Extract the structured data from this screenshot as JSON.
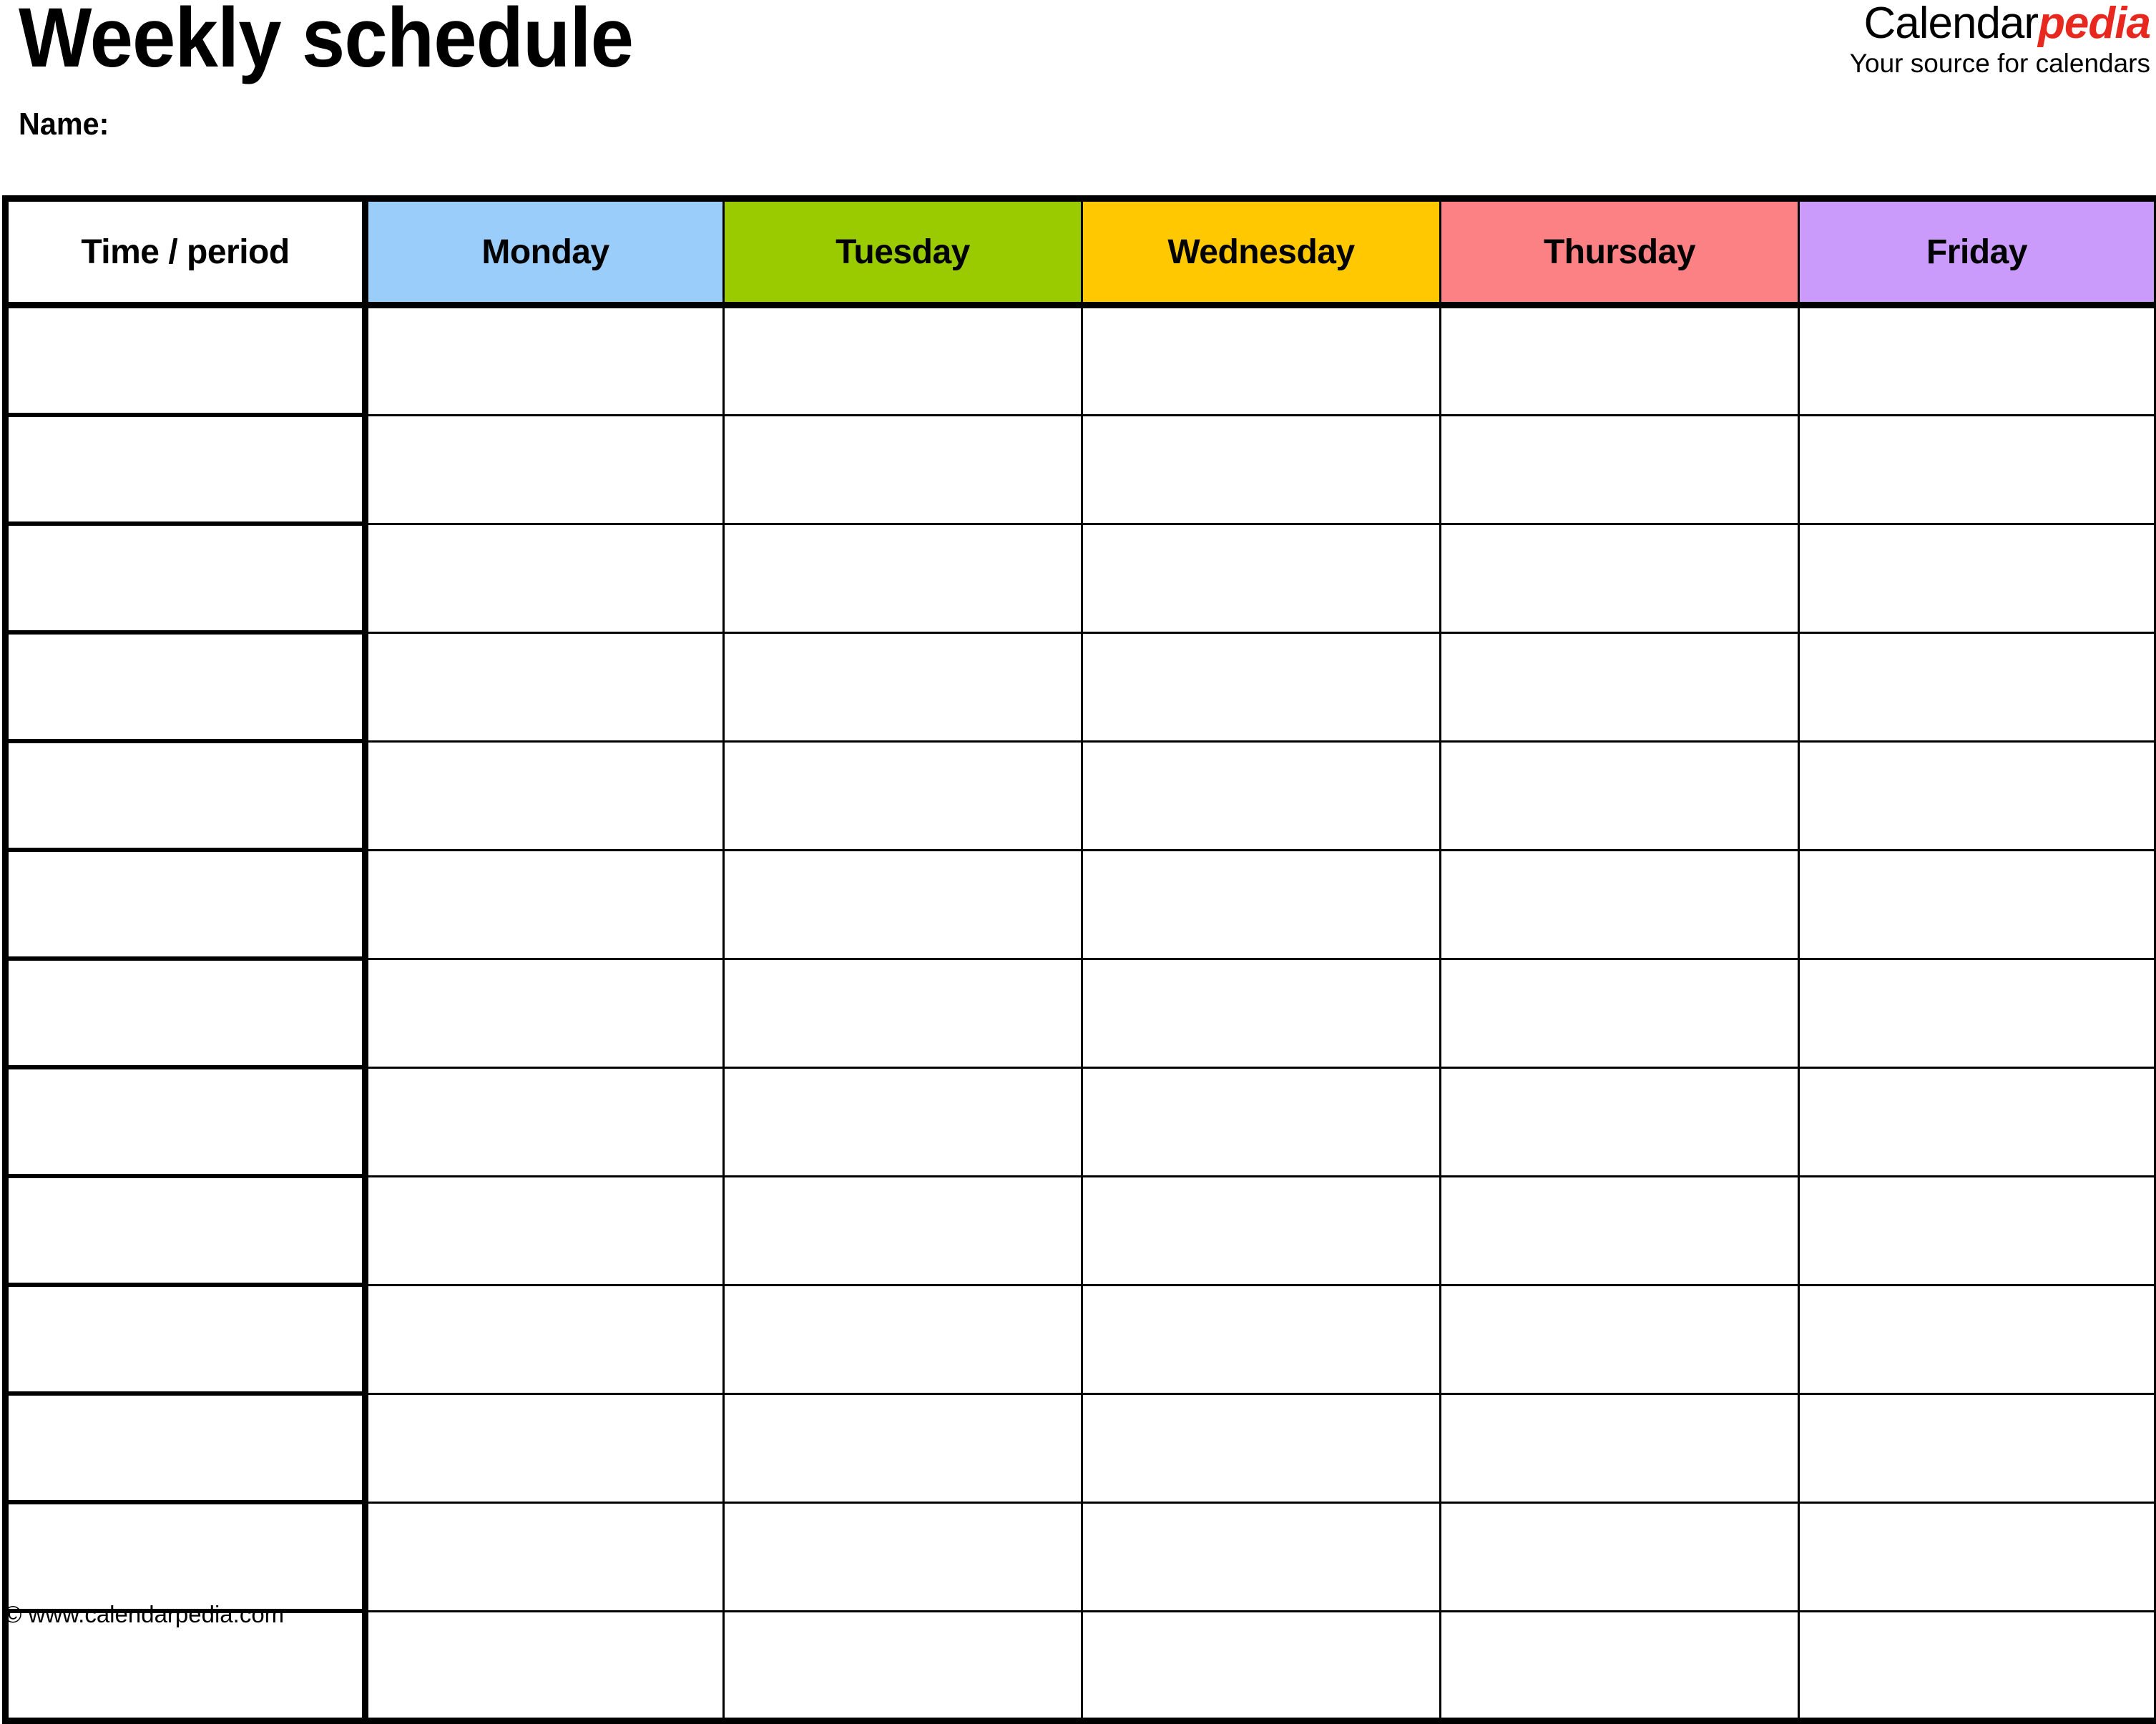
{
  "header": {
    "title": "Weekly schedule",
    "name_label": "Name:"
  },
  "brand": {
    "word_1": "Calendar",
    "word_2": "pedia",
    "tagline": "Your source for calendars",
    "accent_color": "#e8281e"
  },
  "table": {
    "columns": [
      {
        "label": "Time / period",
        "color": "#ffffff"
      },
      {
        "label": "Monday",
        "color": "#9bcdfb"
      },
      {
        "label": "Tuesday",
        "color": "#9aca00"
      },
      {
        "label": "Wednesday",
        "color": "#ffc800"
      },
      {
        "label": "Thursday",
        "color": "#fb8184"
      },
      {
        "label": "Friday",
        "color": "#cb9bfb"
      }
    ],
    "row_count": 13,
    "rows": [
      [
        "",
        "",
        "",
        "",
        "",
        ""
      ],
      [
        "",
        "",
        "",
        "",
        "",
        ""
      ],
      [
        "",
        "",
        "",
        "",
        "",
        ""
      ],
      [
        "",
        "",
        "",
        "",
        "",
        ""
      ],
      [
        "",
        "",
        "",
        "",
        "",
        ""
      ],
      [
        "",
        "",
        "",
        "",
        "",
        ""
      ],
      [
        "",
        "",
        "",
        "",
        "",
        ""
      ],
      [
        "",
        "",
        "",
        "",
        "",
        ""
      ],
      [
        "",
        "",
        "",
        "",
        "",
        ""
      ],
      [
        "",
        "",
        "",
        "",
        "",
        ""
      ],
      [
        "",
        "",
        "",
        "",
        "",
        ""
      ],
      [
        "",
        "",
        "",
        "",
        "",
        ""
      ],
      [
        "",
        "",
        "",
        "",
        "",
        ""
      ]
    ]
  },
  "footer": {
    "copyright": "© www.calendarpedia.com"
  }
}
